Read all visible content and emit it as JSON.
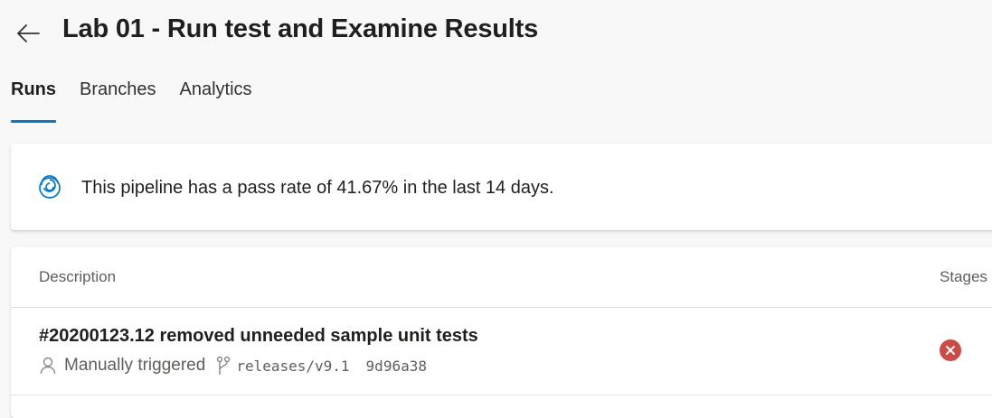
{
  "header": {
    "title": "Lab 01 - Run test and Examine Results"
  },
  "tabs": [
    {
      "label": "Runs",
      "active": true
    },
    {
      "label": "Branches",
      "active": false
    },
    {
      "label": "Analytics",
      "active": false
    }
  ],
  "pass_rate": {
    "message": "This pipeline has a pass rate of 41.67% in the last 14 days."
  },
  "runs_table": {
    "columns": [
      "Description",
      "Stages"
    ],
    "rows": [
      {
        "title": "#20200123.12 removed unneeded sample unit tests",
        "trigger": "Manually triggered",
        "branch": "releases/v9.1",
        "commit": "9d96a38",
        "stage_status": "failed",
        "stage_status_icon": "error-circle-icon"
      }
    ]
  },
  "colors": {
    "accent": "#0078d4",
    "failed": "#cd4a45",
    "background": "#f8f8f8",
    "card": "#ffffff"
  }
}
